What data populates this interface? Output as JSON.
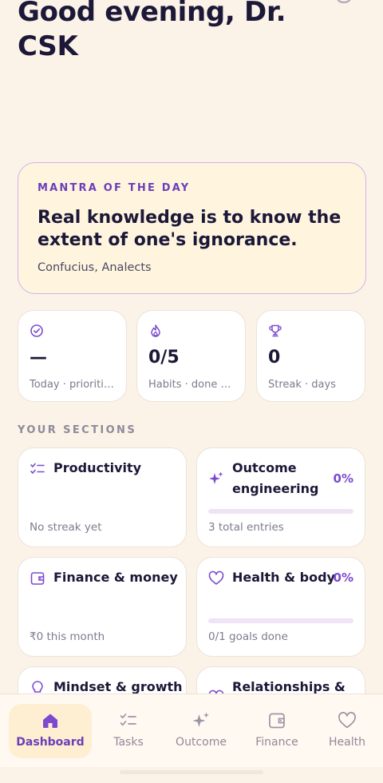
{
  "header": {
    "greeting": "Good evening, Dr. CSK"
  },
  "mantra": {
    "label": "MANTRA OF THE DAY",
    "quote": "Real knowledge is to know the extent of one's ignorance.",
    "source": "Confucius, Analects"
  },
  "stats": [
    {
      "icon": "check-circle-icon",
      "value": "—",
      "label": "Today · priorities"
    },
    {
      "icon": "flame-icon",
      "value": "0/5",
      "label": "Habits · done today"
    },
    {
      "icon": "trophy-icon",
      "value": "0",
      "label": "Streak · days"
    }
  ],
  "sections_title": "YOUR SECTIONS",
  "sections": [
    {
      "icon": "tasks-icon",
      "title": "Productivity",
      "percent": "",
      "progress": null,
      "subtitle": "No streak yet"
    },
    {
      "icon": "sparkles-icon",
      "title": "Outcome engineering",
      "percent": "0%",
      "progress": 0,
      "subtitle": "3 total entries"
    },
    {
      "icon": "wallet-icon",
      "title": "Finance & money",
      "percent": "",
      "progress": null,
      "subtitle": "₹0 this month"
    },
    {
      "icon": "heart-icon",
      "title": "Health & body",
      "percent": "0%",
      "progress": 0,
      "subtitle": "0/1 goals done"
    },
    {
      "icon": "lightbulb-icon",
      "title": "Mindset & growth",
      "percent": "",
      "progress": null,
      "subtitle": ""
    },
    {
      "icon": "heart-icon",
      "title": "Relationships &",
      "percent": "",
      "progress": null,
      "subtitle": ""
    }
  ],
  "nav": [
    {
      "icon": "home-icon",
      "label": "Dashboard",
      "active": true
    },
    {
      "icon": "tasks-icon",
      "label": "Tasks",
      "active": false
    },
    {
      "icon": "sparkles-icon",
      "label": "Outcome",
      "active": false
    },
    {
      "icon": "wallet-icon",
      "label": "Finance",
      "active": false
    },
    {
      "icon": "heart-icon",
      "label": "Health",
      "active": false
    }
  ],
  "colors": {
    "background": "#fbf2e8",
    "accent": "#7c4ad0",
    "mantra_bg": "#fff5df",
    "active_nav_bg": "#ffefd2",
    "text_dark": "#1c1838"
  }
}
